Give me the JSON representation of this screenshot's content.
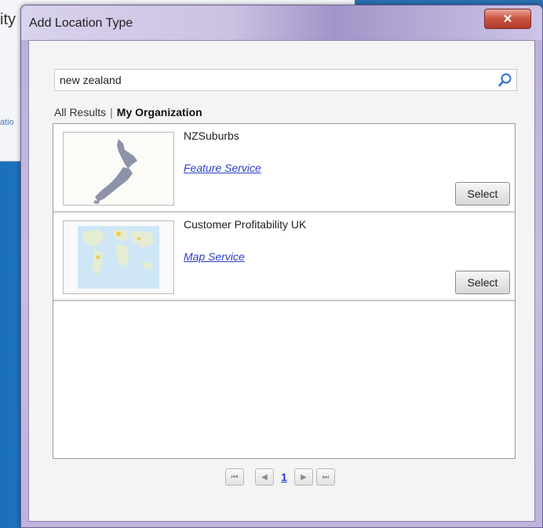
{
  "background": {
    "app_title_fragment": "ity",
    "link_fragment": "atio"
  },
  "dialog": {
    "title": "Add Location Type",
    "close_glyph": "✕"
  },
  "search": {
    "value": "new zealand",
    "placeholder": ""
  },
  "filters": {
    "all_results": "All Results",
    "separator": "|",
    "my_organization": "My Organization"
  },
  "results": [
    {
      "title": "NZSuburbs",
      "type": "Feature Service",
      "select_label": "Select",
      "thumbnail": "new-zealand-map"
    },
    {
      "title": "Customer Profitability UK",
      "type": "Map Service",
      "select_label": "Select",
      "thumbnail": "world-map"
    }
  ],
  "pager": {
    "first": "⏮",
    "prev": "◀",
    "page": "1",
    "next": "▶",
    "last": "⏭"
  },
  "colors": {
    "link": "#2b3fc7",
    "dialog_frame": "#bdb3dc",
    "close_button": "#c9523f"
  }
}
